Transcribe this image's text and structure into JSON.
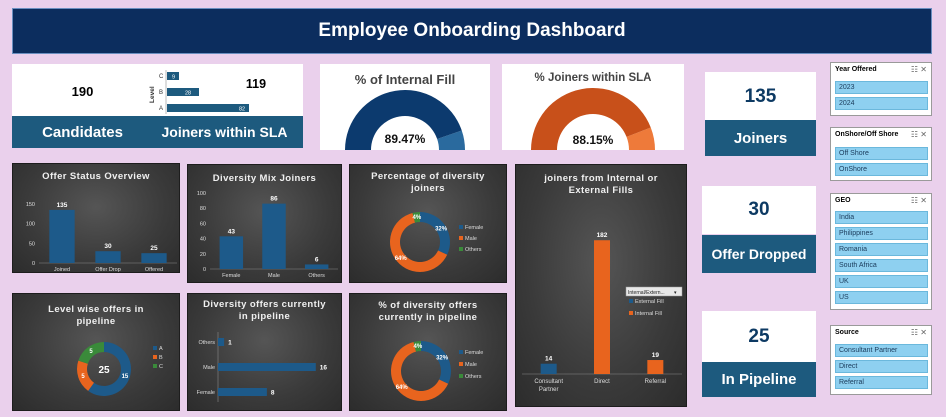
{
  "title": "Employee Onboarding Dashboard",
  "kpis": {
    "candidates": {
      "value": "190",
      "label": "Candidates"
    },
    "joiners_sla": {
      "value": "119",
      "label": "Joiners within SLA"
    },
    "joiners": {
      "value": "135",
      "label": "Joiners"
    },
    "offer_dropped": {
      "value": "30",
      "label": "Offer Dropped"
    },
    "in_pipeline": {
      "value": "25",
      "label": "In Pipeline"
    }
  },
  "level_mini": {
    "axis_label": "Level",
    "rows": [
      {
        "cat": "C",
        "value": "9"
      },
      {
        "cat": "B",
        "value": "28"
      },
      {
        "cat": "A",
        "value": "82"
      }
    ]
  },
  "gauges": {
    "internal_fill": {
      "title": "% of Internal Fill",
      "value": "89.47%",
      "fraction": 0.8947,
      "color": "#0c3a6e",
      "rest": "#2a6a9e"
    },
    "joiners_sla": {
      "title": "% Joiners within SLA",
      "value": "88.15%",
      "fraction": 0.8815,
      "color": "#c8501a",
      "rest": "#ee7a3a"
    }
  },
  "slicers": {
    "year": {
      "title": "Year Offered",
      "items": [
        "2023",
        "2024"
      ]
    },
    "shore": {
      "title": "OnShore/Off Shore",
      "items": [
        "Off Shore",
        "OnShore"
      ]
    },
    "geo": {
      "title": "GEO",
      "items": [
        "India",
        "Philippines",
        "Romania",
        "South Africa",
        "UK",
        "US"
      ]
    },
    "source": {
      "title": "Source",
      "items": [
        "Consultant Partner",
        "Direct",
        "Referral"
      ]
    }
  },
  "chart_data": [
    {
      "id": "offer_status",
      "type": "bar",
      "title": "Offer Status Overview",
      "categories": [
        "Joined",
        "Offer Drop",
        "Offered"
      ],
      "values": [
        135,
        30,
        25
      ],
      "yticks": [
        "0",
        "50",
        "100",
        "150"
      ],
      "ylim": [
        0,
        150
      ]
    },
    {
      "id": "diversity_mix",
      "type": "bar",
      "title": "Diversity Mix Joiners",
      "categories": [
        "Female",
        "Male",
        "Others"
      ],
      "values": [
        43,
        86,
        6
      ],
      "yticks": [
        "0",
        "20",
        "40",
        "60",
        "80",
        "100"
      ],
      "ylim": [
        0,
        100
      ]
    },
    {
      "id": "pct_diversity",
      "type": "pie",
      "title": "Percentage of diversity joiners",
      "labels": [
        "Female",
        "Male",
        "Others"
      ],
      "values": [
        32,
        64,
        4
      ],
      "data_labels": [
        "32%",
        "64%",
        "4%"
      ],
      "colors": [
        "#1d5a8a",
        "#e8641e",
        "#3a8a3a"
      ]
    },
    {
      "id": "internal_external",
      "type": "bar",
      "title": "joiners from Internal or External Fills",
      "categories": [
        "Consultant Partner",
        "Direct",
        "Referral"
      ],
      "series": [
        {
          "name": "External Fill",
          "values": [
            14,
            null,
            null
          ],
          "color": "#1d5a8a"
        },
        {
          "name": "Internal Fill",
          "values": [
            null,
            182,
            19
          ],
          "color": "#e8641e"
        }
      ],
      "ylim": [
        0,
        200
      ],
      "filter_label": "Internal/Extern..."
    },
    {
      "id": "level_pipeline",
      "type": "pie",
      "title": "Level wise offers in pipeline",
      "labels": [
        "A",
        "B",
        "C"
      ],
      "values": [
        15,
        5,
        5
      ],
      "data_labels": [
        "15",
        "5",
        "5"
      ],
      "center": "25",
      "colors": [
        "#1d5a8a",
        "#e8641e",
        "#3a8a3a"
      ]
    },
    {
      "id": "diversity_pipeline",
      "type": "bar",
      "title": "Diversity offers currently in pipeline",
      "categories": [
        "Others",
        "Male",
        "Female"
      ],
      "values": [
        1,
        16,
        8
      ],
      "xlim": [
        0,
        18
      ]
    },
    {
      "id": "pct_diversity_pipeline",
      "type": "pie",
      "title": "% of diversity offers currently in pipeline",
      "labels": [
        "Female",
        "Male",
        "Others"
      ],
      "values": [
        32,
        64,
        4
      ],
      "data_labels": [
        "32%",
        "64%",
        "4%"
      ],
      "colors": [
        "#1d5a8a",
        "#e8641e",
        "#3a8a3a"
      ]
    }
  ]
}
